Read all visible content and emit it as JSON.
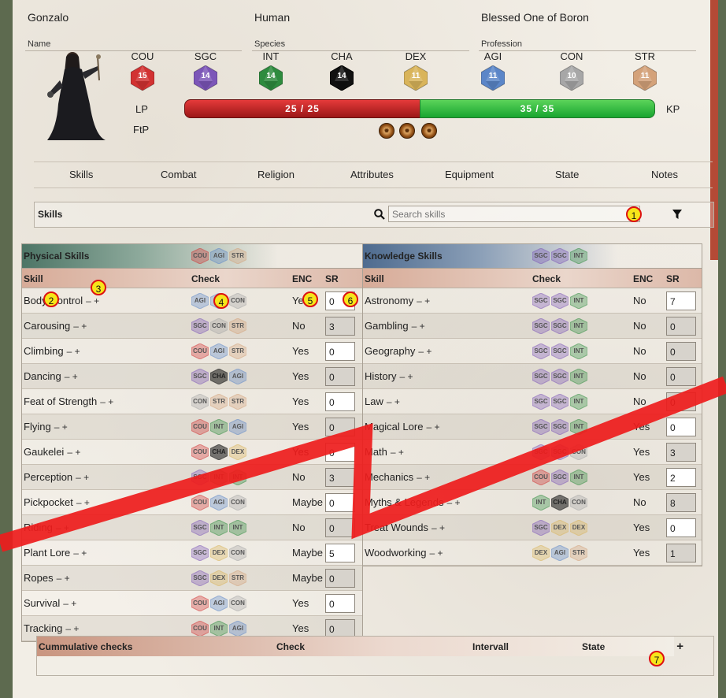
{
  "character": {
    "name": "Gonzalo",
    "name_label": "Name",
    "species": "Human",
    "species_label": "Species",
    "profession": "Blessed One of Boron",
    "profession_label": "Profession"
  },
  "attributes": [
    {
      "abbr": "COU",
      "value": "15",
      "color": "#d23232"
    },
    {
      "abbr": "SGC",
      "value": "14",
      "color": "#7c56b8"
    },
    {
      "abbr": "INT",
      "value": "14",
      "color": "#2e8b3e"
    },
    {
      "abbr": "CHA",
      "value": "14",
      "color": "#111111"
    },
    {
      "abbr": "DEX",
      "value": "11",
      "color": "#d9b45a"
    },
    {
      "abbr": "AGI",
      "value": "11",
      "color": "#5b86c8"
    },
    {
      "abbr": "CON",
      "value": "10",
      "color": "#a7a7a7"
    },
    {
      "abbr": "STR",
      "value": "11",
      "color": "#d4a27a"
    }
  ],
  "vitals": {
    "lp_label": "LP",
    "lp_text": "25  /  25",
    "lp_fraction": 1.0,
    "kp_label": "KP",
    "kp_text": "35  /  35",
    "kp_fraction": 1.0,
    "ftp_label": "FtP",
    "fate_points": 3
  },
  "tabs": [
    "Skills",
    "Combat",
    "Religion",
    "Attributes",
    "Equipment",
    "State",
    "Notes"
  ],
  "skills_header": {
    "title": "Skills",
    "search_placeholder": "Search skills"
  },
  "columns": {
    "skill": "Skill",
    "check": "Check",
    "enc": "ENC",
    "sr": "SR"
  },
  "physical": {
    "title": "Physical Skills",
    "attrs": [
      "COU",
      "AGI",
      "STR"
    ],
    "rows": [
      {
        "name": "Body Control",
        "check": [
          "AGI",
          "AGI",
          "CON"
        ],
        "enc": "Yes",
        "sr": "0",
        "editable": true
      },
      {
        "name": "Carousing",
        "check": [
          "SGC",
          "CON",
          "STR"
        ],
        "enc": "No",
        "sr": "3",
        "editable": false
      },
      {
        "name": "Climbing",
        "check": [
          "COU",
          "AGI",
          "STR"
        ],
        "enc": "Yes",
        "sr": "0",
        "editable": true
      },
      {
        "name": "Dancing",
        "check": [
          "SGC",
          "CHA",
          "AGI"
        ],
        "enc": "Yes",
        "sr": "0",
        "editable": false
      },
      {
        "name": "Feat of Strength",
        "check": [
          "CON",
          "STR",
          "STR"
        ],
        "enc": "Yes",
        "sr": "0",
        "editable": true
      },
      {
        "name": "Flying",
        "check": [
          "COU",
          "INT",
          "AGI"
        ],
        "enc": "Yes",
        "sr": "0",
        "editable": false
      },
      {
        "name": "Gaukelei",
        "check": [
          "COU",
          "CHA",
          "DEX"
        ],
        "enc": "Yes",
        "sr": "0",
        "editable": true
      },
      {
        "name": "Perception",
        "check": [
          "SGC",
          "INT",
          "INT"
        ],
        "enc": "No",
        "sr": "3",
        "editable": false
      },
      {
        "name": "Pickpocket",
        "check": [
          "COU",
          "AGI",
          "CON"
        ],
        "enc": "Maybe",
        "sr": "0",
        "editable": true
      },
      {
        "name": "Riding",
        "check": [
          "SGC",
          "INT",
          "INT"
        ],
        "enc": "No",
        "sr": "0",
        "editable": false
      },
      {
        "name": "Plant Lore",
        "check": [
          "SGC",
          "DEX",
          "CON"
        ],
        "enc": "Maybe",
        "sr": "5",
        "editable": true
      },
      {
        "name": "Ropes",
        "check": [
          "SGC",
          "DEX",
          "STR"
        ],
        "enc": "Maybe",
        "sr": "0",
        "editable": false
      },
      {
        "name": "Survival",
        "check": [
          "COU",
          "AGI",
          "CON"
        ],
        "enc": "Yes",
        "sr": "0",
        "editable": true
      },
      {
        "name": "Tracking",
        "check": [
          "COU",
          "INT",
          "AGI"
        ],
        "enc": "Yes",
        "sr": "0",
        "editable": false
      }
    ]
  },
  "knowledge": {
    "title": "Knowledge Skills",
    "attrs": [
      "SGC",
      "SGC",
      "INT"
    ],
    "rows": [
      {
        "name": "Astronomy",
        "check": [
          "SGC",
          "SGC",
          "INT"
        ],
        "enc": "No",
        "sr": "7",
        "editable": true
      },
      {
        "name": "Gambling",
        "check": [
          "SGC",
          "SGC",
          "INT"
        ],
        "enc": "No",
        "sr": "0",
        "editable": false
      },
      {
        "name": "Geography",
        "check": [
          "SGC",
          "SGC",
          "INT"
        ],
        "enc": "No",
        "sr": "0",
        "editable": false
      },
      {
        "name": "History",
        "check": [
          "SGC",
          "SGC",
          "INT"
        ],
        "enc": "No",
        "sr": "0",
        "editable": false
      },
      {
        "name": "Law",
        "check": [
          "SGC",
          "SGC",
          "INT"
        ],
        "enc": "No",
        "sr": "0",
        "editable": false
      },
      {
        "name": "Magical Lore",
        "check": [
          "SGC",
          "SGC",
          "INT"
        ],
        "enc": "Yes",
        "sr": "0",
        "editable": true
      },
      {
        "name": "Math",
        "check": [
          "SGC",
          "SGC",
          "CON"
        ],
        "enc": "Yes",
        "sr": "3",
        "editable": false
      },
      {
        "name": "Mechanics",
        "check": [
          "COU",
          "SGC",
          "INT"
        ],
        "enc": "Yes",
        "sr": "2",
        "editable": true
      },
      {
        "name": "Myths & Legends",
        "check": [
          "INT",
          "CHA",
          "CON"
        ],
        "enc": "No",
        "sr": "8",
        "editable": false
      },
      {
        "name": "Treat Wounds",
        "check": [
          "SGC",
          "DEX",
          "DEX"
        ],
        "enc": "Yes",
        "sr": "0",
        "editable": true
      },
      {
        "name": "Woodworking",
        "check": [
          "DEX",
          "AGI",
          "STR"
        ],
        "enc": "Yes",
        "sr": "1",
        "editable": false
      }
    ]
  },
  "cumulative": {
    "title": "Cummulative checks",
    "check": "Check",
    "interval": "Intervall",
    "state": "State",
    "add": "+"
  },
  "plus_minus": "–  +",
  "markers": [
    "1",
    "2",
    "3",
    "4",
    "5",
    "6",
    "7"
  ]
}
